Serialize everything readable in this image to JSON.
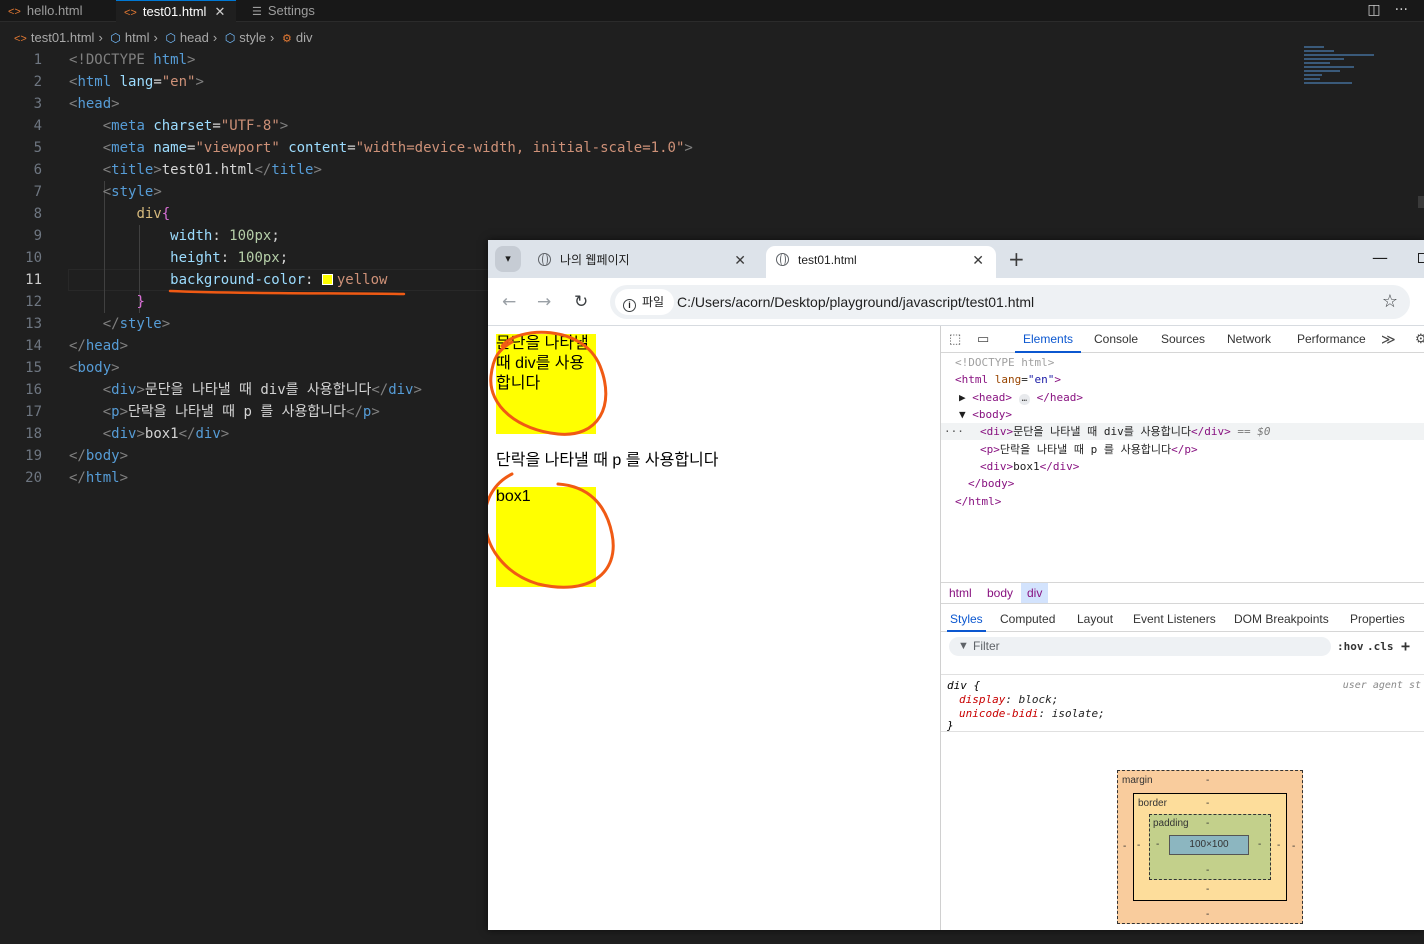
{
  "vscode": {
    "tabs": [
      {
        "label": "hello.html",
        "icon": "html-icon"
      },
      {
        "label": "test01.html",
        "icon": "html-icon",
        "active": true
      },
      {
        "label": "Settings",
        "icon": "settings-icon"
      }
    ],
    "breadcrumb": [
      "test01.html",
      "html",
      "head",
      "style",
      "div"
    ],
    "lines": [
      {
        "n": "1"
      },
      {
        "n": "2"
      },
      {
        "n": "3"
      },
      {
        "n": "4"
      },
      {
        "n": "5"
      },
      {
        "n": "6"
      },
      {
        "n": "7"
      },
      {
        "n": "8"
      },
      {
        "n": "9"
      },
      {
        "n": "10"
      },
      {
        "n": "11"
      },
      {
        "n": "12"
      },
      {
        "n": "13"
      },
      {
        "n": "14"
      },
      {
        "n": "15"
      },
      {
        "n": "16"
      },
      {
        "n": "17"
      },
      {
        "n": "18"
      },
      {
        "n": "19"
      },
      {
        "n": "20"
      }
    ],
    "code": {
      "l1_a": "<!DOCTYPE",
      "l1_b": " html",
      "l1_c": ">",
      "l2_tag": "html",
      "l2_attr": "lang",
      "l2_val": "\"en\"",
      "l3_tag": "head",
      "l4_tag": "meta",
      "l4_attr": "charset",
      "l4_val": "\"UTF-8\"",
      "l5_tag": "meta",
      "l5_attr1": "name",
      "l5_val1": "\"viewport\"",
      "l5_attr2": "content",
      "l5_val2": "\"width=device-width, initial-scale=1.0\"",
      "l6_tag": "title",
      "l6_text": "test01.html",
      "l7_tag": "style",
      "l8_sel": "div",
      "l8_brace": "{",
      "l9_prop": "width",
      "l9_val": "100px",
      "l10_prop": "height",
      "l10_val": "100px",
      "l11_prop": "background-color",
      "l11_val": "yellow",
      "l12_brace": "}",
      "l13_tag": "style",
      "l14_tag": "head",
      "l15_tag": "body",
      "l16_tag": "div",
      "l16_text": "문단을 나타낼 때 div를 사용합니다",
      "l17_tag": "p",
      "l17_text": "단락을 나타낼 때 p 를 사용합니다",
      "l18_tag": "div",
      "l18_text": "box1",
      "l19_tag": "body",
      "l20_tag": "html"
    }
  },
  "browser": {
    "tabs": [
      {
        "label": "나의 웹페이지"
      },
      {
        "label": "test01.html",
        "active": true
      }
    ],
    "site_chip": "파일",
    "url": "C:/Users/acorn/Desktop/playground/javascript/test01.html",
    "page": {
      "div1": "문단을 나타낼 때 div를 사용합니다",
      "p1": "단락을 나타낼 때 p 를 사용합니다",
      "div2": "box1"
    },
    "annotation_color": "#f05a14",
    "highlight_color": "#ffff00"
  },
  "devtools": {
    "tabs": [
      "Elements",
      "Console",
      "Sources",
      "Network",
      "Performance"
    ],
    "dom": {
      "doctype": "<!DOCTYPE html>",
      "html_open": "html",
      "lang_attr": "lang",
      "lang_val": "\"en\"",
      "head": "head",
      "body": "body",
      "div1_text": "문단을 나타낼 때 div를 사용합니다",
      "div1_hint": " == $0",
      "p_text": "단락을 나타낼 때 p 를 사용합니다",
      "div2_text": "box1",
      "body_close": "</body>",
      "html_close": "</html>"
    },
    "crumbs": [
      "html",
      "body",
      "div"
    ],
    "style_tabs": [
      "Styles",
      "Computed",
      "Layout",
      "Event Listeners",
      "DOM Breakpoints",
      "Properties"
    ],
    "filter_placeholder": "Filter",
    "hov": ":hov",
    "cls": ".cls",
    "rule": {
      "selector": "div {",
      "origin": "user agent st",
      "decls": [
        {
          "prop": "display",
          "val": "block"
        },
        {
          "prop": "unicode-bidi",
          "val": "isolate"
        }
      ],
      "close": "}"
    },
    "box_model": {
      "margin_label": "margin",
      "border_label": "border",
      "padding_label": "padding",
      "dash": "-",
      "content": "100×100"
    }
  }
}
